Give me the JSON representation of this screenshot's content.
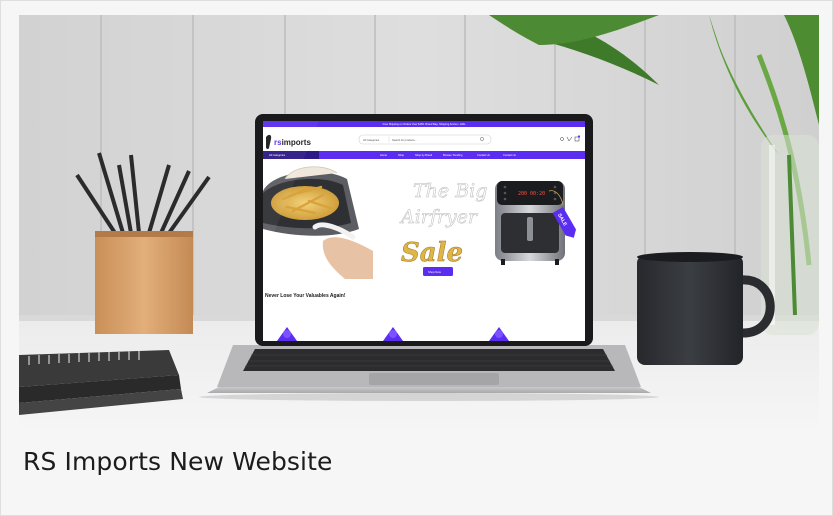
{
  "caption": "RS Imports New Website",
  "photo": {
    "scene": "laptop on white desk showing RS Imports website",
    "colors": {
      "brand_purple": "#5b2df0",
      "desk": "#efefef",
      "wall": "#d7d7d7",
      "mug": "#2f3136",
      "pencil_holder": "#d8a46f"
    }
  },
  "website": {
    "topbar_text": "Free Shipping on Orders Over $150. Brand Bag. Shipping Across • Gifts",
    "logo_prefix": "rs",
    "logo_suffix": "imports",
    "search_category": "All Categories",
    "search_placeholder": "Search for products...",
    "categories_label": "All Categories",
    "nav": [
      "Home",
      "Shop",
      "Shop by Brand",
      "Browse Trending",
      "Contact Us",
      "Contact Us"
    ],
    "hero_line1": "The Big",
    "hero_line2": "Airfryer",
    "hero_line3": "Sale",
    "hero_tag": "SALE",
    "airfryer_display": "200 00:20",
    "shop_button": "Shop Now",
    "section_heading": "Never Lose Your Valuables Again!"
  }
}
